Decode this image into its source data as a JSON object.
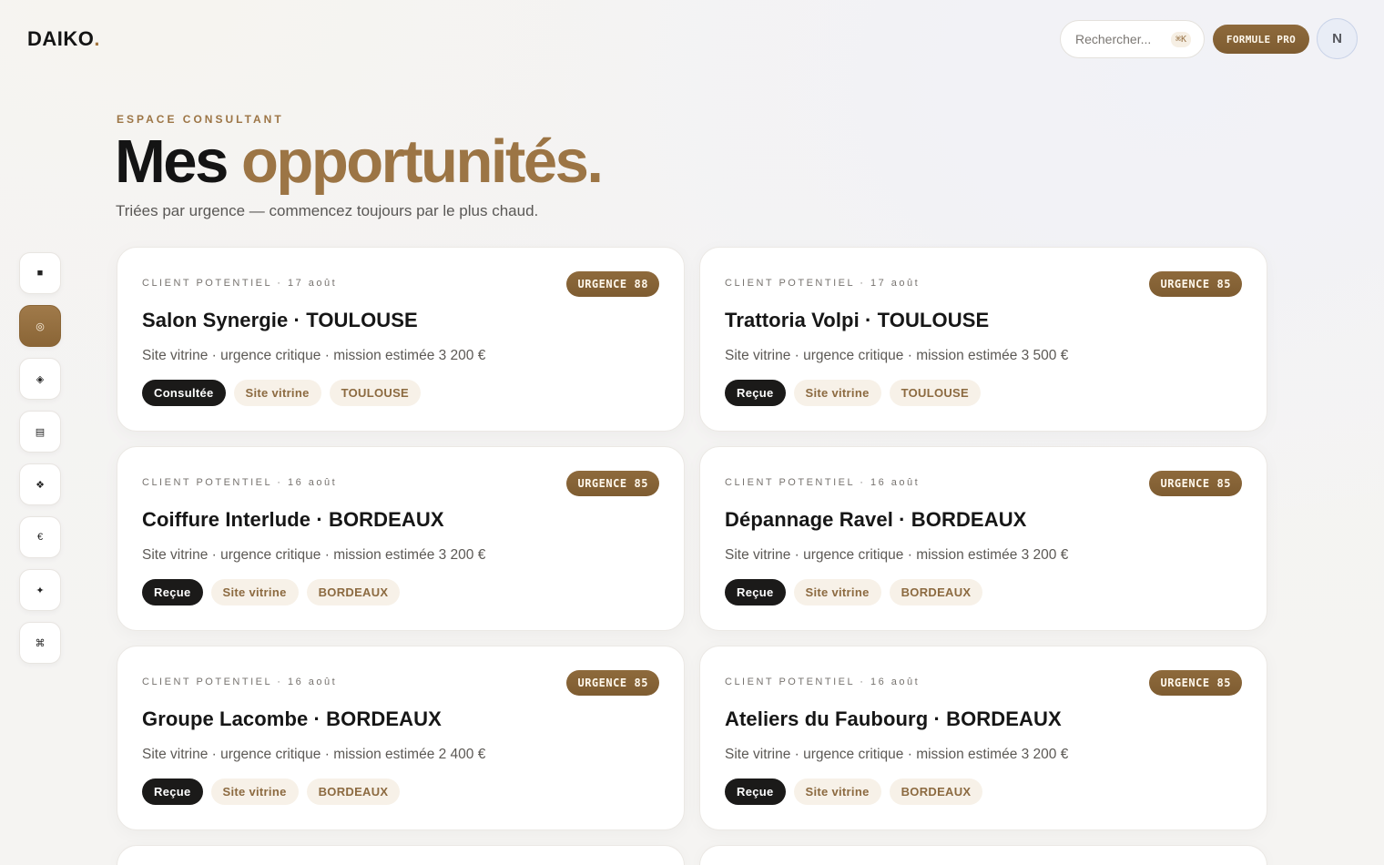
{
  "header": {
    "logo": "DAIKO",
    "logo_dot": ".",
    "search_placeholder": "Rechercher...",
    "search_shortcut": "⌘K",
    "pro_button": "FORMULE PRO",
    "avatar_initial": "N"
  },
  "page": {
    "eyebrow": "ESPACE CONSULTANT",
    "title_plain": "Mes",
    "title_accent": "opportunités.",
    "subtitle": "Triées par urgence — commencez toujours par le plus chaud."
  },
  "sidebar": {
    "items": [
      {
        "name": "grid",
        "glyph": "■"
      },
      {
        "name": "target",
        "glyph": "◎"
      },
      {
        "name": "diamond",
        "glyph": "◈"
      },
      {
        "name": "document",
        "glyph": "▤"
      },
      {
        "name": "network",
        "glyph": "❖"
      },
      {
        "name": "euro",
        "glyph": "€"
      },
      {
        "name": "sparkle",
        "glyph": "✦"
      },
      {
        "name": "command",
        "glyph": "⌘"
      }
    ]
  },
  "cards": [
    {
      "meta": "CLIENT POTENTIEL · 17 août",
      "badge_label": "URGENCE",
      "badge_score": "88",
      "name": "Salon Synergie · TOULOUSE",
      "desc": "Site vitrine · urgence critique · mission estimée 3 200 €",
      "status": "Consultée",
      "kind": "Site vitrine",
      "city": "TOULOUSE"
    },
    {
      "meta": "CLIENT POTENTIEL · 17 août",
      "badge_label": "URGENCE",
      "badge_score": "85",
      "name": "Trattoria Volpi · TOULOUSE",
      "desc": "Site vitrine · urgence critique · mission estimée 3 500 €",
      "status": "Reçue",
      "kind": "Site vitrine",
      "city": "TOULOUSE"
    },
    {
      "meta": "CLIENT POTENTIEL · 16 août",
      "badge_label": "URGENCE",
      "badge_score": "85",
      "name": "Coiffure Interlude · BORDEAUX",
      "desc": "Site vitrine · urgence critique · mission estimée 3 200 €",
      "status": "Reçue",
      "kind": "Site vitrine",
      "city": "BORDEAUX"
    },
    {
      "meta": "CLIENT POTENTIEL · 16 août",
      "badge_label": "URGENCE",
      "badge_score": "85",
      "name": "Dépannage Ravel · BORDEAUX",
      "desc": "Site vitrine · urgence critique · mission estimée 3 200 €",
      "status": "Reçue",
      "kind": "Site vitrine",
      "city": "BORDEAUX"
    },
    {
      "meta": "CLIENT POTENTIEL · 16 août",
      "badge_label": "URGENCE",
      "badge_score": "85",
      "name": "Groupe Lacombe · BORDEAUX",
      "desc": "Site vitrine · urgence critique · mission estimée 2 400 €",
      "status": "Reçue",
      "kind": "Site vitrine",
      "city": "BORDEAUX"
    },
    {
      "meta": "CLIENT POTENTIEL · 16 août",
      "badge_label": "URGENCE",
      "badge_score": "85",
      "name": "Ateliers du Faubourg · BORDEAUX",
      "desc": "Site vitrine · urgence critique · mission estimée 3 200 €",
      "status": "Reçue",
      "kind": "Site vitrine",
      "city": "BORDEAUX"
    }
  ]
}
